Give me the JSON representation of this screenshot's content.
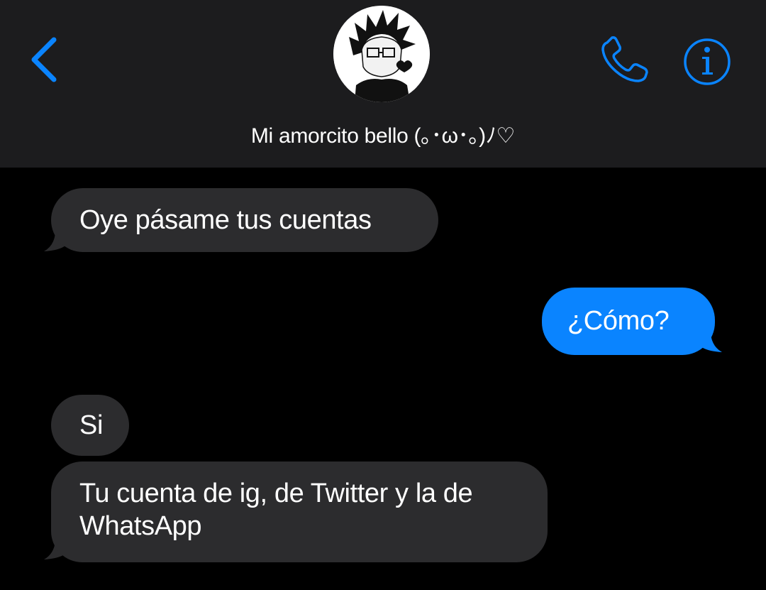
{
  "header": {
    "contact_name": "Mi amorcito bello (｡･ω･｡)ﾉ♡",
    "icons": {
      "back": "chevron-left-icon",
      "call": "phone-icon",
      "info": "info-icon"
    },
    "accent_color": "#0a84ff"
  },
  "messages": [
    {
      "direction": "received",
      "text": "Oye pásame tus cuentas"
    },
    {
      "direction": "sent",
      "text": "¿Cómo?"
    },
    {
      "direction": "received",
      "text": "Si"
    },
    {
      "direction": "received",
      "text": "Tu cuenta de ig, de Twitter y la de WhatsApp"
    }
  ],
  "colors": {
    "header_bg": "#1c1c1e",
    "received_bubble": "#2c2c2e",
    "sent_bubble": "#0a84ff",
    "background": "#000000"
  }
}
